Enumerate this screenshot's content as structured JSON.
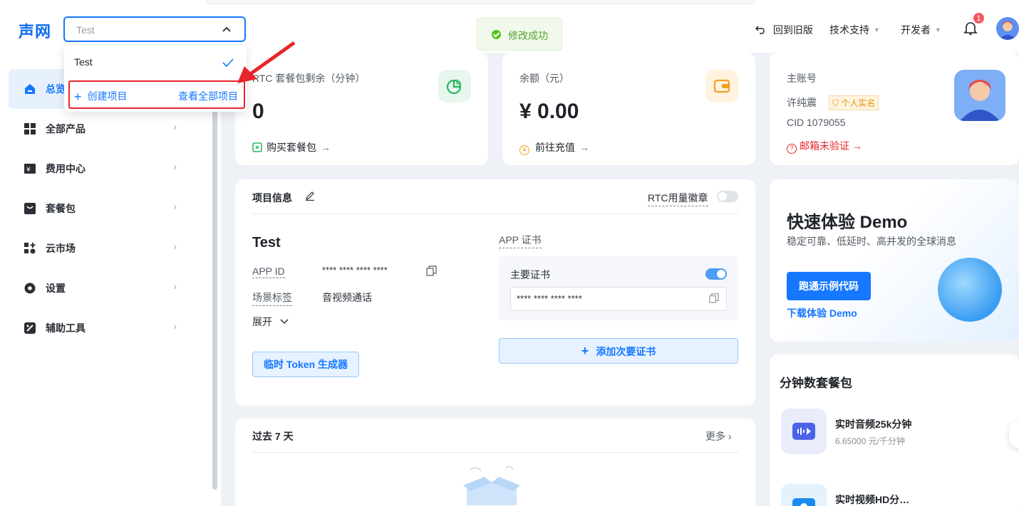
{
  "brand": {
    "logo_text": "声网",
    "accent": "#1677ff"
  },
  "project_select": {
    "value": "Test"
  },
  "dropdown": {
    "option": "Test",
    "create_label": "创建项目",
    "view_all_label": "查看全部项目"
  },
  "toast": {
    "text": "修改成功"
  },
  "header": {
    "back_label": "回到旧版",
    "support_label": "技术支持",
    "developer_label": "开发者",
    "notification_count": "1"
  },
  "sidebar": {
    "items": [
      {
        "label": "总览"
      },
      {
        "label": "全部产品"
      },
      {
        "label": "费用中心"
      },
      {
        "label": "套餐包"
      },
      {
        "label": "云市场"
      },
      {
        "label": "设置"
      },
      {
        "label": "辅助工具"
      }
    ]
  },
  "rtc_card": {
    "title": "RTC 套餐包剩余（分钟）",
    "value": "0",
    "link": "购买套餐包"
  },
  "balance_card": {
    "title": "余额（元）",
    "value": "¥ 0.00",
    "link": "前往充值"
  },
  "account_card": {
    "title": "主账号",
    "name": "许纯震",
    "badge": "个人实名",
    "cid": "CID 1079055",
    "warning": "邮箱未验证"
  },
  "project_info": {
    "title": "项目信息",
    "usage_badge_label": "RTC用量徽章",
    "project_name": "Test",
    "app_id_label": "APP ID",
    "app_id_value": "**** **** **** ****",
    "scene_label": "场景标签",
    "scene_value": "音视频通话",
    "expand_label": "展开",
    "token_button": "临时 Token 生成器",
    "cert_title": "APP 证书",
    "primary_cert_label": "主要证书",
    "primary_cert_value": "**** **** **** ****",
    "add_cert_button": "添加次要证书"
  },
  "past": {
    "title": "过去 7 天",
    "more": "更多"
  },
  "demo": {
    "title": "快速体验 Demo",
    "subtitle": "稳定可靠、低延时、高并发的全球消息",
    "run_button": "跑通示例代码",
    "download_link": "下载体验 Demo"
  },
  "packages": {
    "title": "分钟数套餐包",
    "items": [
      {
        "name": "实时音频25k分钟",
        "price": "6.65000 元/千分钟"
      },
      {
        "name": "实时视频HD分…",
        "price": ""
      }
    ]
  }
}
